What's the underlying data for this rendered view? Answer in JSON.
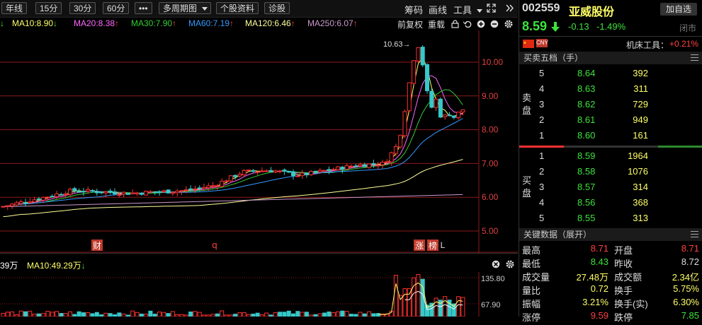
{
  "toolbar": {
    "period_year": "年线",
    "period_15": "15分",
    "period_30": "30分",
    "period_60": "60分",
    "more": "•••",
    "multi_period": "多周期图",
    "stock_info": "个股资料",
    "diagnose": "诊股",
    "chips": "筹码",
    "draw": "画线",
    "tools": "工具",
    "fullscreen_icon": "expand-icon",
    "collapse_icon": "double-chevron-right-icon"
  },
  "ma_legend": {
    "ma10": "MA10:8.90",
    "ma20": "MA20:8.38",
    "ma30": "MA30:7.90",
    "ma60": "MA60:7.19",
    "ma120": "MA120:6.46",
    "ma250": "MA250:6.07",
    "ma10_arrow": "↓",
    "ma20_arrow": "↑",
    "ma30_arrow": "↑",
    "ma60_arrow": "↑",
    "ma120_arrow": "↑",
    "ma250_arrow": "↑",
    "fq": "前复权",
    "overlay": "重载",
    "lead_arrow": "↓",
    "colors": {
      "ma10": "#ffff66",
      "ma20": "#ff66ff",
      "ma30": "#33cc33",
      "ma60": "#3399ff",
      "ma120": "#ffff99",
      "ma250": "#cc99cc"
    }
  },
  "chart": {
    "price_ticks": [
      "10.00",
      "9.00",
      "8.00",
      "7.00",
      "6.00",
      "5.00"
    ],
    "high_label": "10.63→",
    "markers": [
      "财",
      "q",
      "涨",
      "榜",
      "L"
    ]
  },
  "volume": {
    "legend_left": "39万",
    "legend_ma10": "MA10:49.29万",
    "ma10_arrow": "↓",
    "ticks": [
      "135.80",
      "67.90"
    ]
  },
  "stock": {
    "code": "002559",
    "name": "亚威股份",
    "add_fav": "加自选",
    "price": "8.59",
    "arrow": "↓",
    "change": "-0.13",
    "pct": "-1.49%",
    "status": "闭市",
    "industry": "机床工具",
    "industry_change": "+0.21%",
    "flag_label": "CNY"
  },
  "order_book": {
    "title": "买卖五档（手）",
    "sell_label": [
      "卖",
      "盘"
    ],
    "buy_label": [
      "买",
      "盘"
    ],
    "sell": [
      {
        "level": "5",
        "price": "8.64",
        "vol": "392"
      },
      {
        "level": "4",
        "price": "8.63",
        "vol": "311"
      },
      {
        "level": "3",
        "price": "8.62",
        "vol": "729"
      },
      {
        "level": "2",
        "price": "8.61",
        "vol": "949"
      },
      {
        "level": "1",
        "price": "8.60",
        "vol": "161"
      }
    ],
    "buy": [
      {
        "level": "1",
        "price": "8.59",
        "vol": "1964"
      },
      {
        "level": "2",
        "price": "8.58",
        "vol": "1076"
      },
      {
        "level": "3",
        "price": "8.57",
        "vol": "314"
      },
      {
        "level": "4",
        "price": "8.56",
        "vol": "368"
      },
      {
        "level": "5",
        "price": "8.55",
        "vol": "313"
      }
    ]
  },
  "key_data": {
    "title": "关键数据（展开）",
    "rows": [
      {
        "l1": "最高",
        "v1": "8.71",
        "l2": "开盘",
        "v2": "8.71"
      },
      {
        "l1": "最低",
        "v1": "8.43",
        "l2": "昨收",
        "v2": "8.72"
      },
      {
        "l1": "成交量",
        "v1": "27.48万",
        "l2": "成交额",
        "v2": "2.34亿"
      },
      {
        "l1": "量比",
        "v1": "0.72",
        "l2": "换手",
        "v2": "5.75%"
      },
      {
        "l1": "振幅",
        "v1": "3.21%",
        "l2": "换手(实)",
        "v2": "6.30%"
      },
      {
        "l1": "涨停",
        "v1": "9.59",
        "l2": "跌停",
        "v2": "7.85"
      }
    ]
  }
}
